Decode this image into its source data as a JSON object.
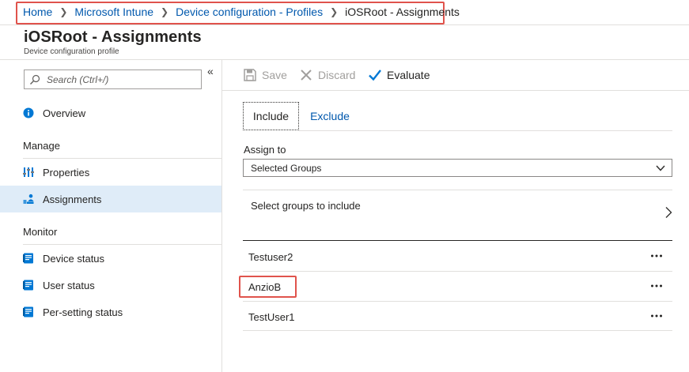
{
  "breadcrumb": {
    "items": [
      "Home",
      "Microsoft Intune",
      "Device configuration - Profiles"
    ],
    "current": "iOSRoot - Assignments"
  },
  "header": {
    "title": "iOSRoot - Assignments",
    "subtitle": "Device configuration profile"
  },
  "sidebar": {
    "search_placeholder": "Search (Ctrl+/)",
    "collapse_glyph": "«",
    "overview": {
      "label": "Overview",
      "icon": "info-icon"
    },
    "sections": [
      {
        "label": "Manage"
      },
      {
        "label": "Monitor"
      }
    ],
    "manage_items": [
      {
        "label": "Properties",
        "icon": "properties-icon"
      },
      {
        "label": "Assignments",
        "icon": "assignments-icon",
        "selected": true
      }
    ],
    "monitor_items": [
      {
        "label": "Device status",
        "icon": "device-status-icon"
      },
      {
        "label": "User status",
        "icon": "user-status-icon"
      },
      {
        "label": "Per-setting status",
        "icon": "per-setting-status-icon"
      }
    ]
  },
  "toolbar": {
    "save_label": "Save",
    "discard_label": "Discard",
    "evaluate_label": "Evaluate"
  },
  "tabs": {
    "include": "Include",
    "exclude": "Exclude",
    "active": "Include"
  },
  "assign": {
    "label": "Assign to",
    "selected": "Selected Groups"
  },
  "select_groups": {
    "label": "Select groups to include"
  },
  "groups": [
    {
      "name": "Testuser2"
    },
    {
      "name": "AnzioB",
      "highlighted": true
    },
    {
      "name": "TestUser1"
    }
  ],
  "colors": {
    "accent": "#0058ad",
    "selected_bg": "#dfecf8",
    "highlight": "#e0534c",
    "icon_blue": "#0078d4"
  }
}
